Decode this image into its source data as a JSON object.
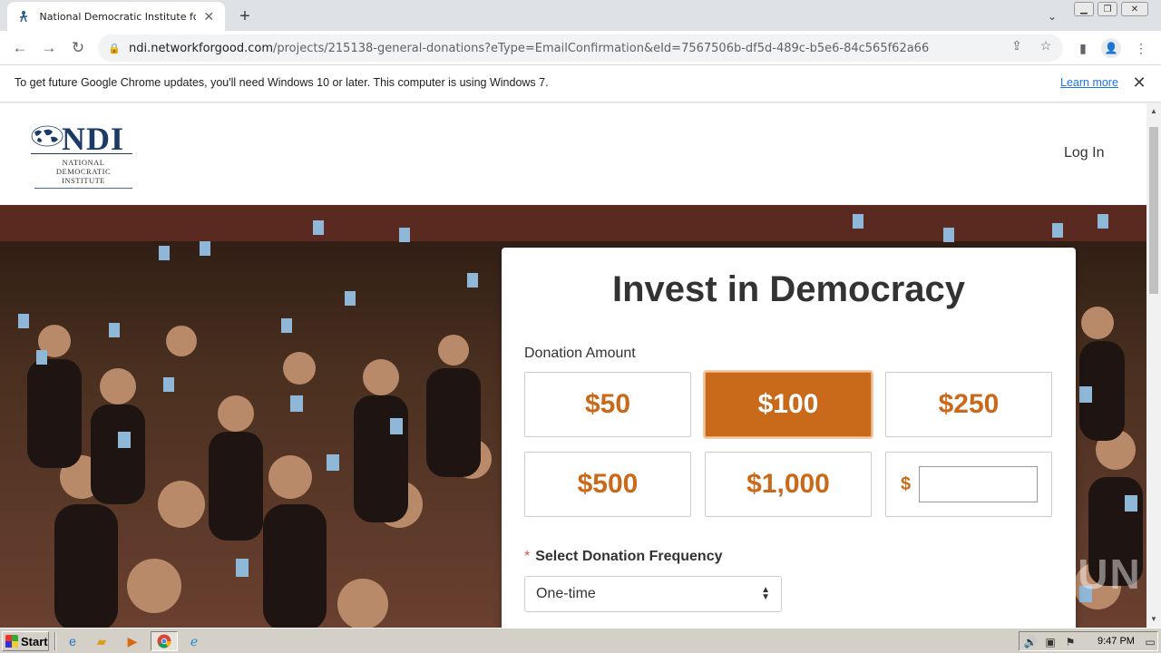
{
  "browser": {
    "tab_title": "National Democratic Institute for International Affairs",
    "url_host": "ndi.networkforgood.com",
    "url_path": "/projects/215138-general-donations?eType=EmailConfirmation&eId=7567506b-df5d-489c-b5e6-84c565f62a66"
  },
  "infobar": {
    "message": "To get future Google Chrome updates, you'll need Windows 10 or later. This computer is using Windows 7.",
    "link": "Learn more"
  },
  "site": {
    "logo_mark": "NDI",
    "logo_line1": "NATIONAL",
    "logo_line2": "DEMOCRATIC",
    "logo_line3": "INSTITUTE",
    "login": "Log In"
  },
  "form": {
    "heading": "Invest in Democracy",
    "amount_label": "Donation Amount",
    "amounts": [
      "$50",
      "$100",
      "$250",
      "$500",
      "$1,000"
    ],
    "selected_amount": "$100",
    "custom_prefix": "$",
    "custom_value": "",
    "frequency_required": "*",
    "frequency_label": "Select Donation Frequency",
    "frequency_value": "One-time"
  },
  "watermark": "ANY RUN",
  "taskbar": {
    "start": "Start",
    "clock": "9:47 PM"
  },
  "colors": {
    "accent": "#c96a1b",
    "navy": "#1b3a66"
  }
}
